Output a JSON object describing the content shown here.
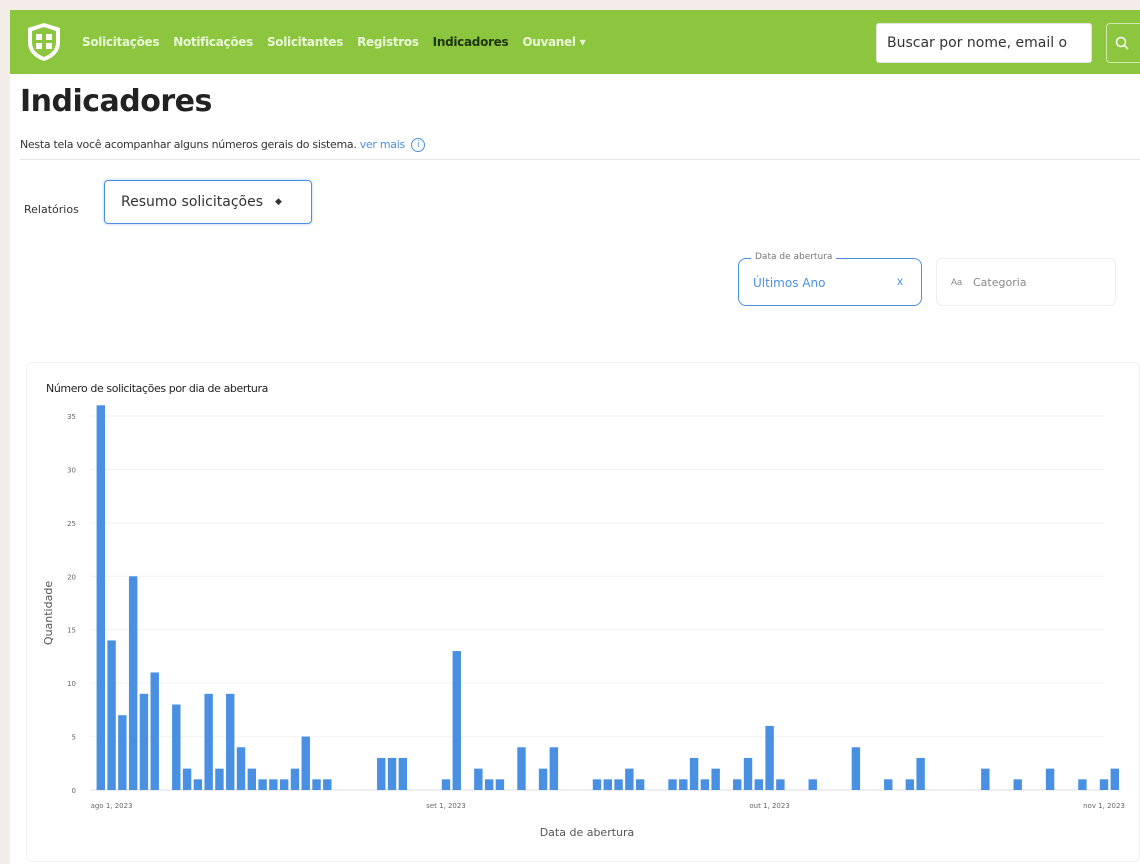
{
  "colors": {
    "nav": "#8cc63f",
    "accent": "#4a90e2",
    "bar": "#4a90e2"
  },
  "navbar": {
    "logo_icon": "shield-logo-icon",
    "items": [
      {
        "label": "Solicitações"
      },
      {
        "label": "Notificações"
      },
      {
        "label": "Solicitantes"
      },
      {
        "label": "Registros"
      },
      {
        "label": "Indicadores",
        "active": true
      },
      {
        "label": "Ouvanel ▾"
      }
    ],
    "search": {
      "placeholder": "Buscar por nome, email o"
    },
    "search_button_icon": "search-icon"
  },
  "header": {
    "title": "Indicadores",
    "description": "Nesta tela você acompanhar alguns números gerais do sistema.",
    "more_link": "ver mais",
    "info_icon": "info-icon"
  },
  "report": {
    "label": "Relatórios",
    "selected": "Resumo solicitações"
  },
  "filters": {
    "date": {
      "legend": "Data de abertura",
      "value": "Últimos Ano",
      "clear": "x"
    },
    "category": {
      "icon": "text-type-icon",
      "placeholder": "Categoria"
    }
  },
  "chart_data": {
    "type": "bar",
    "title": "Número de solicitações por dia de abertura",
    "xlabel": "Data de abertura",
    "ylabel": "Quantidade",
    "ylim": [
      0,
      35
    ],
    "yticks": [
      0,
      5,
      10,
      15,
      20,
      25,
      30,
      35
    ],
    "xlim": [
      "2023-07-30",
      "2023-11-01"
    ],
    "xticks": [
      {
        "date": "2023-08-01",
        "label": "ago 1, 2023"
      },
      {
        "date": "2023-09-01",
        "label": "set 1, 2023"
      },
      {
        "date": "2023-10-01",
        "label": "out 1, 2023"
      },
      {
        "date": "2023-11-01",
        "label": "nov 1, 2023"
      }
    ],
    "grid": true,
    "x": [
      "2023-07-31",
      "2023-08-01",
      "2023-08-02",
      "2023-08-03",
      "2023-08-04",
      "2023-08-05",
      "2023-08-07",
      "2023-08-08",
      "2023-08-09",
      "2023-08-10",
      "2023-08-11",
      "2023-08-12",
      "2023-08-13",
      "2023-08-14",
      "2023-08-15",
      "2023-08-16",
      "2023-08-17",
      "2023-08-18",
      "2023-08-19",
      "2023-08-20",
      "2023-08-21",
      "2023-08-26",
      "2023-08-27",
      "2023-08-28",
      "2023-09-01",
      "2023-09-02",
      "2023-09-04",
      "2023-09-05",
      "2023-09-06",
      "2023-09-08",
      "2023-09-10",
      "2023-09-11",
      "2023-09-15",
      "2023-09-16",
      "2023-09-17",
      "2023-09-18",
      "2023-09-19",
      "2023-09-22",
      "2023-09-23",
      "2023-09-24",
      "2023-09-25",
      "2023-09-26",
      "2023-09-28",
      "2023-09-29",
      "2023-09-30",
      "2023-10-01",
      "2023-10-02",
      "2023-10-05",
      "2023-10-09",
      "2023-10-12",
      "2023-10-14",
      "2023-10-15",
      "2023-10-21",
      "2023-10-24",
      "2023-10-27",
      "2023-10-30",
      "2023-11-01",
      "2023-11-02"
    ],
    "values": [
      36,
      14,
      7,
      20,
      9,
      11,
      8,
      2,
      1,
      9,
      2,
      9,
      4,
      2,
      1,
      1,
      1,
      2,
      5,
      1,
      1,
      3,
      3,
      3,
      1,
      13,
      2,
      1,
      1,
      4,
      2,
      4,
      1,
      1,
      1,
      2,
      1,
      1,
      1,
      3,
      1,
      2,
      1,
      3,
      1,
      6,
      1,
      1,
      4,
      1,
      1,
      3,
      2,
      1,
      2,
      1,
      1,
      2
    ]
  }
}
